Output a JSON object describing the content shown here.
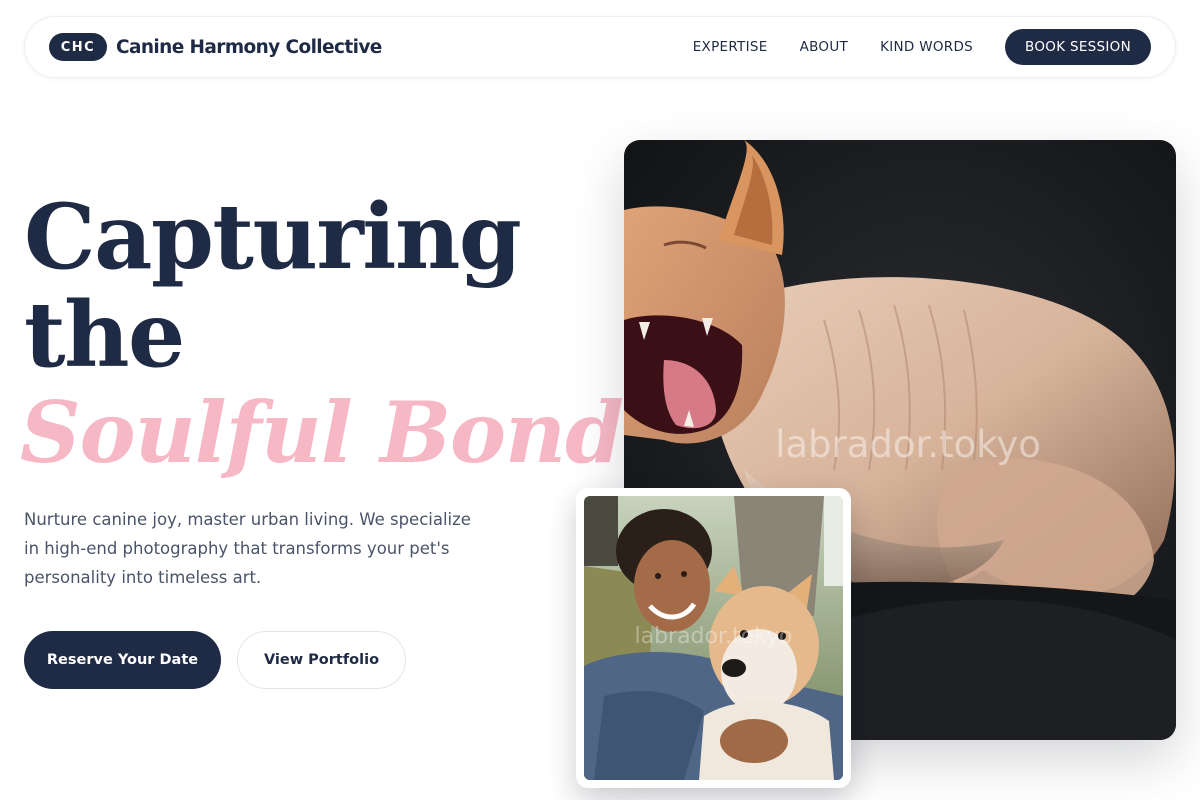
{
  "header": {
    "logo_badge": "CHC",
    "brand_name": "Canine Harmony Collective",
    "nav": [
      "EXPERTISE",
      "ABOUT",
      "KIND WORDS"
    ],
    "cta": "BOOK SESSION"
  },
  "hero": {
    "line1": "Capturing",
    "line2": "the",
    "accent": "Soulful Bond",
    "description": "Nurture canine joy, master urban living. We specialize in high-end photography that transforms your pet's personality into timeless art.",
    "primary_button": "Reserve Your Date",
    "secondary_button": "View Portfolio"
  },
  "media": {
    "main_watermark": "labrador.tokyo",
    "inset_watermark": "labrador.tokyo"
  },
  "colors": {
    "navy": "#1f2a44",
    "accent_pink": "#f7b8c6",
    "body_text": "#4a5468"
  }
}
